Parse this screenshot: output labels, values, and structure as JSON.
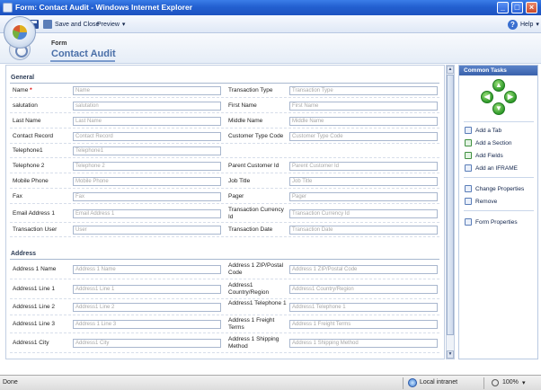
{
  "window": {
    "title": "Form: Contact Audit - Windows Internet Explorer"
  },
  "toolbar": {
    "save_close": "Save and Close",
    "preview": "Preview",
    "preview_caret": "▾",
    "help": "Help",
    "help_caret": "▾"
  },
  "header": {
    "small": "Form",
    "title": "Contact Audit"
  },
  "sections": {
    "general": "General",
    "address": "Address"
  },
  "general_rows": [
    {
      "l1": "Name",
      "req": true,
      "p1": "Name",
      "l2": "Transaction Type",
      "p2": "Transaction Type"
    },
    {
      "l1": "salutation",
      "p1": "salutation",
      "l2": "First Name",
      "p2": "First Name"
    },
    {
      "l1": "Last Name",
      "p1": "Last Name",
      "l2": "Middle Name",
      "p2": "Middle Name"
    },
    {
      "l1": "Contact Record",
      "p1": "Contact Record",
      "l2": "Customer Type Code",
      "p2": "Customer Type Code"
    },
    {
      "l1": "Telephone1",
      "p1": "Telephone1",
      "l2": "",
      "p2": ""
    },
    {
      "l1": "Telephone 2",
      "p1": "Telephone 2",
      "l2": "Parent Customer Id",
      "p2": "Parent Customer Id"
    },
    {
      "l1": "Mobile Phone",
      "p1": "Mobile Phone",
      "l2": "Job Title",
      "p2": "Job Title"
    },
    {
      "l1": "Fax",
      "p1": "Fax",
      "l2": "Pager",
      "p2": "Pager"
    },
    {
      "l1": "Email Address 1",
      "p1": "Email Address 1",
      "l2": "Transaction Currency Id",
      "p2": "Transaction Currency Id"
    },
    {
      "l1": "Transaction User",
      "p1": "User",
      "l2": "Transaction Date",
      "p2": "Transaction Date"
    }
  ],
  "address_rows": [
    {
      "l1": "Address 1 Name",
      "p1": "Address 1 Name",
      "l2": "Address 1 ZIP/Postal Code",
      "p2": "Address 1 ZIP/Postal Code"
    },
    {
      "l1": "Address1 Line 1",
      "p1": "Address1 Line 1",
      "l2": "Address1 Country/Region",
      "p2": "Address1 Country/Region"
    },
    {
      "l1": "Address1 Line 2",
      "p1": "Address1 Line 2",
      "l2": "Address1 Telephone 1",
      "p2": "Address1 Telephone 1"
    },
    {
      "l1": "Address1 Line 3",
      "p1": "Address 1 Line 3",
      "l2": "Address 1 Freight Terms",
      "p2": "Address 1 Freight Terms"
    },
    {
      "l1": "Address1 City",
      "p1": "Address1 City",
      "l2": "Address 1 Shipping Method",
      "p2": "Address 1 Shipping Method"
    }
  ],
  "tasks": {
    "title": "Common Tasks",
    "items": [
      "Add a Tab",
      "Add a Section",
      "Add Fields",
      "Add an IFRAME",
      "Change Properties",
      "Remove",
      "Form Properties"
    ]
  },
  "status": {
    "left": "Done",
    "zone": "Local intranet",
    "zoom": "100%",
    "zoom_caret": "▾"
  }
}
